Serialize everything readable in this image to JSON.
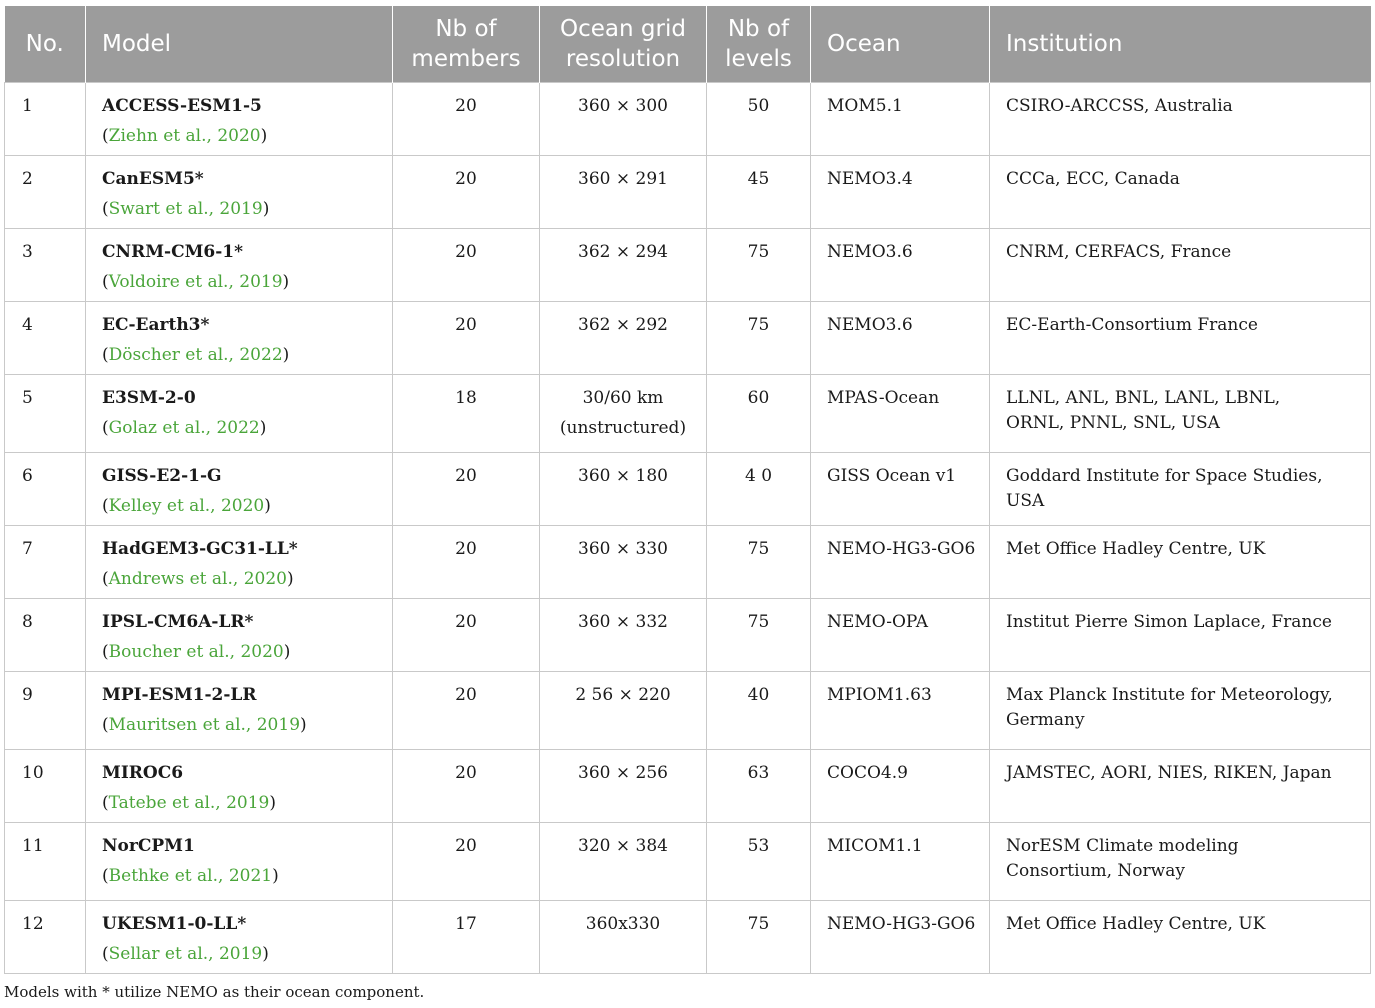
{
  "table": {
    "headers": {
      "no": "No.",
      "model": "Model",
      "members_l1": "Nb of",
      "members_l2": "members",
      "grid_l1": "Ocean grid",
      "grid_l2": "resolution",
      "levels_l1": "Nb of",
      "levels_l2": "levels",
      "ocean": "Ocean",
      "institution": "Institution"
    },
    "rows": [
      {
        "no": "1",
        "model": "ACCESS-ESM1-5",
        "ref": "Ziehn et al., 2020",
        "members": "20",
        "grid": "360 × 300",
        "grid2": "",
        "levels": "50",
        "ocean": "MOM5.1",
        "institution": "CSIRO-ARCCSS, Australia"
      },
      {
        "no": "2",
        "model": "CanESM5*",
        "ref": "Swart et al., 2019",
        "members": "20",
        "grid": "360 × 291",
        "grid2": "",
        "levels": "45",
        "ocean": "NEMO3.4",
        "institution": "CCCa, ECC, Canada"
      },
      {
        "no": "3",
        "model": "CNRM-CM6-1*",
        "ref": "Voldoire et al., 2019",
        "members": "20",
        "grid": "362 × 294",
        "grid2": "",
        "levels": "75",
        "ocean": "NEMO3.6",
        "institution": "CNRM, CERFACS, France"
      },
      {
        "no": "4",
        "model": "EC-Earth3*",
        "ref": "Döscher et al., 2022",
        "members": "20",
        "grid": "362 × 292",
        "grid2": "",
        "levels": "75",
        "ocean": "NEMO3.6",
        "institution": "EC-Earth-Consortium France"
      },
      {
        "no": "5",
        "model": "E3SM-2-0",
        "ref": "Golaz et al., 2022",
        "members": "18",
        "grid": "30/60 km",
        "grid2": "(unstructured)",
        "levels": "60",
        "ocean": "MPAS-Ocean",
        "institution": "LLNL, ANL, BNL, LANL, LBNL, ORNL, PNNL, SNL, USA"
      },
      {
        "no": "6",
        "model": "GISS-E2-1-G",
        "ref": "Kelley et al., 2020",
        "members": "20",
        "grid": "360 × 180",
        "grid2": "",
        "levels": "4 0",
        "ocean": "GISS Ocean v1",
        "institution": "Goddard Institute for Space Studies, USA"
      },
      {
        "no": "7",
        "model": "HadGEM3-GC31-LL*",
        "ref": "Andrews et al., 2020",
        "members": "20",
        "grid": "360 × 330",
        "grid2": "",
        "levels": "75",
        "ocean": "NEMO-HG3-GO6",
        "institution": "Met Office Hadley Centre, UK"
      },
      {
        "no": "8",
        "model": "IPSL-CM6A-LR*",
        "ref": "Boucher et al., 2020",
        "members": "20",
        "grid": "360 × 332",
        "grid2": "",
        "levels": "75",
        "ocean": "NEMO-OPA",
        "institution": "Institut Pierre Simon Laplace, France"
      },
      {
        "no": "9",
        "model": "MPI-ESM1-2-LR",
        "ref": "Mauritsen et al., 2019",
        "members": "20",
        "grid": "2 56 × 220",
        "grid2": "",
        "levels": "40",
        "ocean": "MPIOM1.63",
        "institution": "Max Planck Institute for Meteorology, Germany"
      },
      {
        "no": "10",
        "model": "MIROC6",
        "ref": "Tatebe et al., 2019",
        "members": "20",
        "grid": "360 × 256",
        "grid2": "",
        "levels": "63",
        "ocean": "COCO4.9",
        "institution": "JAMSTEC, AORI, NIES, RIKEN, Japan"
      },
      {
        "no": "11",
        "model": "NorCPM1",
        "ref": "Bethke et al., 2021",
        "members": "20",
        "grid": "320 × 384",
        "grid2": "",
        "levels": "53",
        "ocean": "MICOM1.1",
        "institution": "NorESM Climate modeling Consortium, Norway"
      },
      {
        "no": "12",
        "model": "UKESM1-0-LL*",
        "ref": "Sellar et al., 2019",
        "members": "17",
        "grid": "360x330",
        "grid2": "",
        "levels": "75",
        "ocean": "NEMO-HG3-GO6",
        "institution": "Met Office Hadley Centre, UK"
      }
    ]
  },
  "footnote": "Models with * utilize NEMO as their ocean component.",
  "colors": {
    "header_bg": "#9c9c9c",
    "citation": "#4aa53a",
    "grid_lines": "#c9c9c9"
  }
}
